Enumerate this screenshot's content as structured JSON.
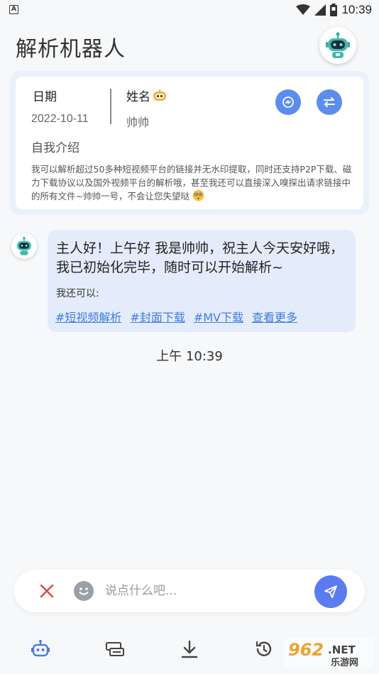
{
  "status_bar": {
    "time": "10:39",
    "left_icon": "A",
    "icons": [
      "wifi-icon",
      "signal-icon",
      "battery-icon"
    ]
  },
  "header": {
    "title": "解析机器人",
    "avatar_icon": "robot-icon"
  },
  "profile": {
    "date_label": "日期",
    "date_value": "2022-10-11",
    "name_label": "姓名",
    "name_emoji": "robot-face-emoji",
    "name_value": "帅帅",
    "intro_label": "自我介绍",
    "intro_text": "我可以解析超过50多种短视频平台的链接并无水印提取，同时还支持P2P下载、磁力下载协议以及国外视频平台的解析哦，甚至我还可以直接深入嗅探出请求链接中的所有文件~帅帅一号，不会让您失望哒",
    "intro_emoji": "flushed-face-emoji",
    "buttons": [
      "refresh-icon",
      "swap-icon"
    ]
  },
  "chat": {
    "message": "主人好！上午好 我是帅帅，祝主人今天安好哦，我已初始化完毕，随时可以开始解析~",
    "sub_label": "我还可以:",
    "links": [
      "#短视频解析",
      "#封面下载",
      "#MV下载",
      "查看更多"
    ],
    "time": "上午 10:39"
  },
  "input": {
    "placeholder": "说点什么吧...",
    "value": ""
  },
  "bottom_nav": {
    "items": [
      "robot-icon",
      "parse-card-icon",
      "download-icon",
      "history-icon"
    ]
  },
  "watermark": {
    "text_top": "962.NET",
    "text_bottom": "乐游网"
  },
  "colors": {
    "accent": "#5b8def",
    "link": "#3f7de0",
    "bubble": "#e4ecfb",
    "clear": "#e5473b"
  }
}
